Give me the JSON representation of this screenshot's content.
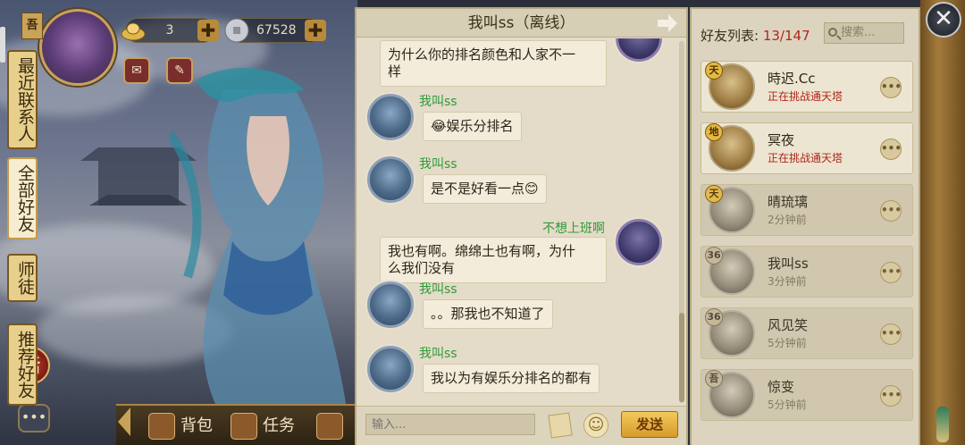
{
  "hud": {
    "vip_badge": "吾",
    "gold_value": "3",
    "silver_value": "67528",
    "plus": "✚",
    "activity_label": "活",
    "chat_label": "•••"
  },
  "bottom_bar": {
    "items": [
      {
        "label": "背包"
      },
      {
        "label": "任务"
      }
    ]
  },
  "chat": {
    "title": "我叫ss（离线）",
    "messages": [
      {
        "sender": "",
        "text_line1": "为什么你的排名颜色和人家不一",
        "text_line2": "样",
        "mine": true
      },
      {
        "sender": "我叫ss",
        "text": "😂娱乐分排名",
        "mine": false
      },
      {
        "sender": "我叫ss",
        "text": "是不是好看一点😊",
        "mine": false
      },
      {
        "sender": "不想上班啊",
        "text_line1": "我也有啊。绵绵土也有啊，为什",
        "text_line2": "么我们没有",
        "mine": true
      },
      {
        "sender": "我叫ss",
        "text": "。。那我也不知道了",
        "mine": false
      },
      {
        "sender": "我叫ss",
        "text": "我以为有娱乐分排名的都有",
        "mine": false
      }
    ],
    "input_placeholder": "输入...",
    "emoji_icon": "☺",
    "send_label": "发送"
  },
  "friends": {
    "title_prefix": "好友列表:",
    "count": "13/147",
    "search_placeholder": "搜索...",
    "list": [
      {
        "tag": "天",
        "name": "時迟.Cc",
        "status": "正在挑战通天塔",
        "online": true
      },
      {
        "tag": "地",
        "name": "冥夜",
        "status": "正在挑战通天塔",
        "online": true
      },
      {
        "tag": "天",
        "name": "晴琉璃",
        "status": "2分钟前",
        "online": false
      },
      {
        "tag": "36",
        "name": "我叫ss",
        "status": "3分钟前",
        "online": false
      },
      {
        "tag": "36",
        "name": "风见笑",
        "status": "5分钟前",
        "online": false
      },
      {
        "tag": "吾",
        "name": "惊变",
        "status": "5分钟前",
        "online": false
      }
    ],
    "more_label": "•••"
  },
  "tabs": [
    {
      "label": "最近联系人",
      "active": false
    },
    {
      "label": "全部好友",
      "active": true
    },
    {
      "label": "师徒",
      "active": false
    },
    {
      "label": "推荐好友",
      "active": false
    }
  ],
  "close_label": "✕"
}
